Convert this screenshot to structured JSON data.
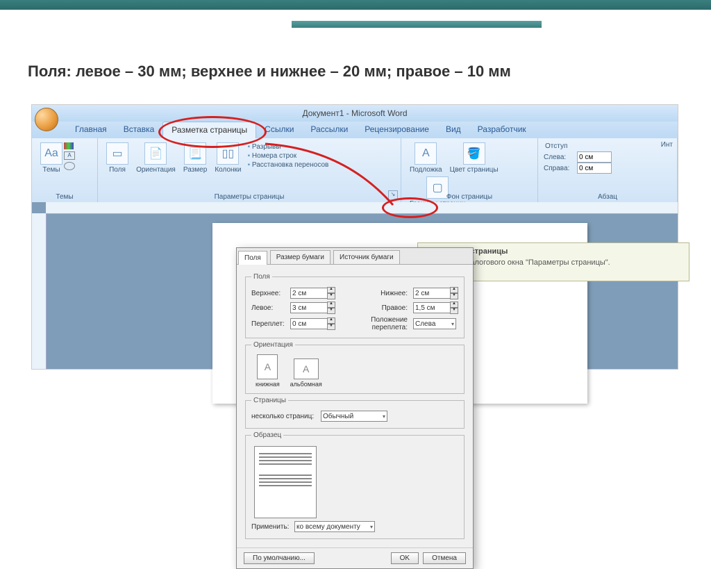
{
  "slide": {
    "title": "Поля: левое – 30 мм; верхнее и нижнее – 20 мм; правое – 10 мм"
  },
  "window_title": "Документ1 - Microsoft Word",
  "tabs": {
    "home": "Главная",
    "insert": "Вставка",
    "layout": "Разметка страницы",
    "refs": "Ссылки",
    "mail": "Рассылки",
    "review": "Рецензирование",
    "view": "Вид",
    "dev": "Разработчик"
  },
  "ribbon": {
    "themes_group": "Темы",
    "themes_btn": "Темы",
    "pagesetup_group": "Параметры страницы",
    "margins": "Поля",
    "orientation": "Ориентация",
    "size": "Размер",
    "columns": "Колонки",
    "breaks": "Разрывы",
    "linenums": "Номера строк",
    "hyphen": "Расстановка переносов",
    "bg_group": "Фон страницы",
    "watermark": "Подложка",
    "pagecolor": "Цвет страницы",
    "borders": "Границы страниц",
    "para_group": "Абзац",
    "indent_label": "Отступ",
    "indent_left_label": "Слева:",
    "indent_right_label": "Справа:",
    "indent_left": "0 см",
    "indent_right": "0 см",
    "int_label": "Инт"
  },
  "tooltip": {
    "title": "Параметры страницы",
    "body": "Открытие диалогового окна \"Параметры страницы\"."
  },
  "dialog": {
    "tab_margins": "Поля",
    "tab_paper": "Размер бумаги",
    "tab_source": "Источник бумаги",
    "fs_margins": "Поля",
    "top_lbl": "Верхнее:",
    "top_val": "2 см",
    "bottom_lbl": "Нижнее:",
    "bottom_val": "2 см",
    "left_lbl": "Левое:",
    "left_val": "3 см",
    "right_lbl": "Правое:",
    "right_val": "1,5 см",
    "gutter_lbl": "Переплет:",
    "gutter_val": "0 см",
    "gutter_pos_lbl": "Положение переплета:",
    "gutter_pos_val": "Слева",
    "fs_orient": "Ориентация",
    "portrait": "книжная",
    "landscape": "альбомная",
    "fs_pages": "Страницы",
    "multipage_lbl": "несколько страниц:",
    "multipage_val": "Обычный",
    "fs_preview": "Образец",
    "apply_lbl": "Применить:",
    "apply_val": "ко всему документу",
    "default_btn": "По умолчанию...",
    "ok": "OK",
    "cancel": "Отмена"
  }
}
